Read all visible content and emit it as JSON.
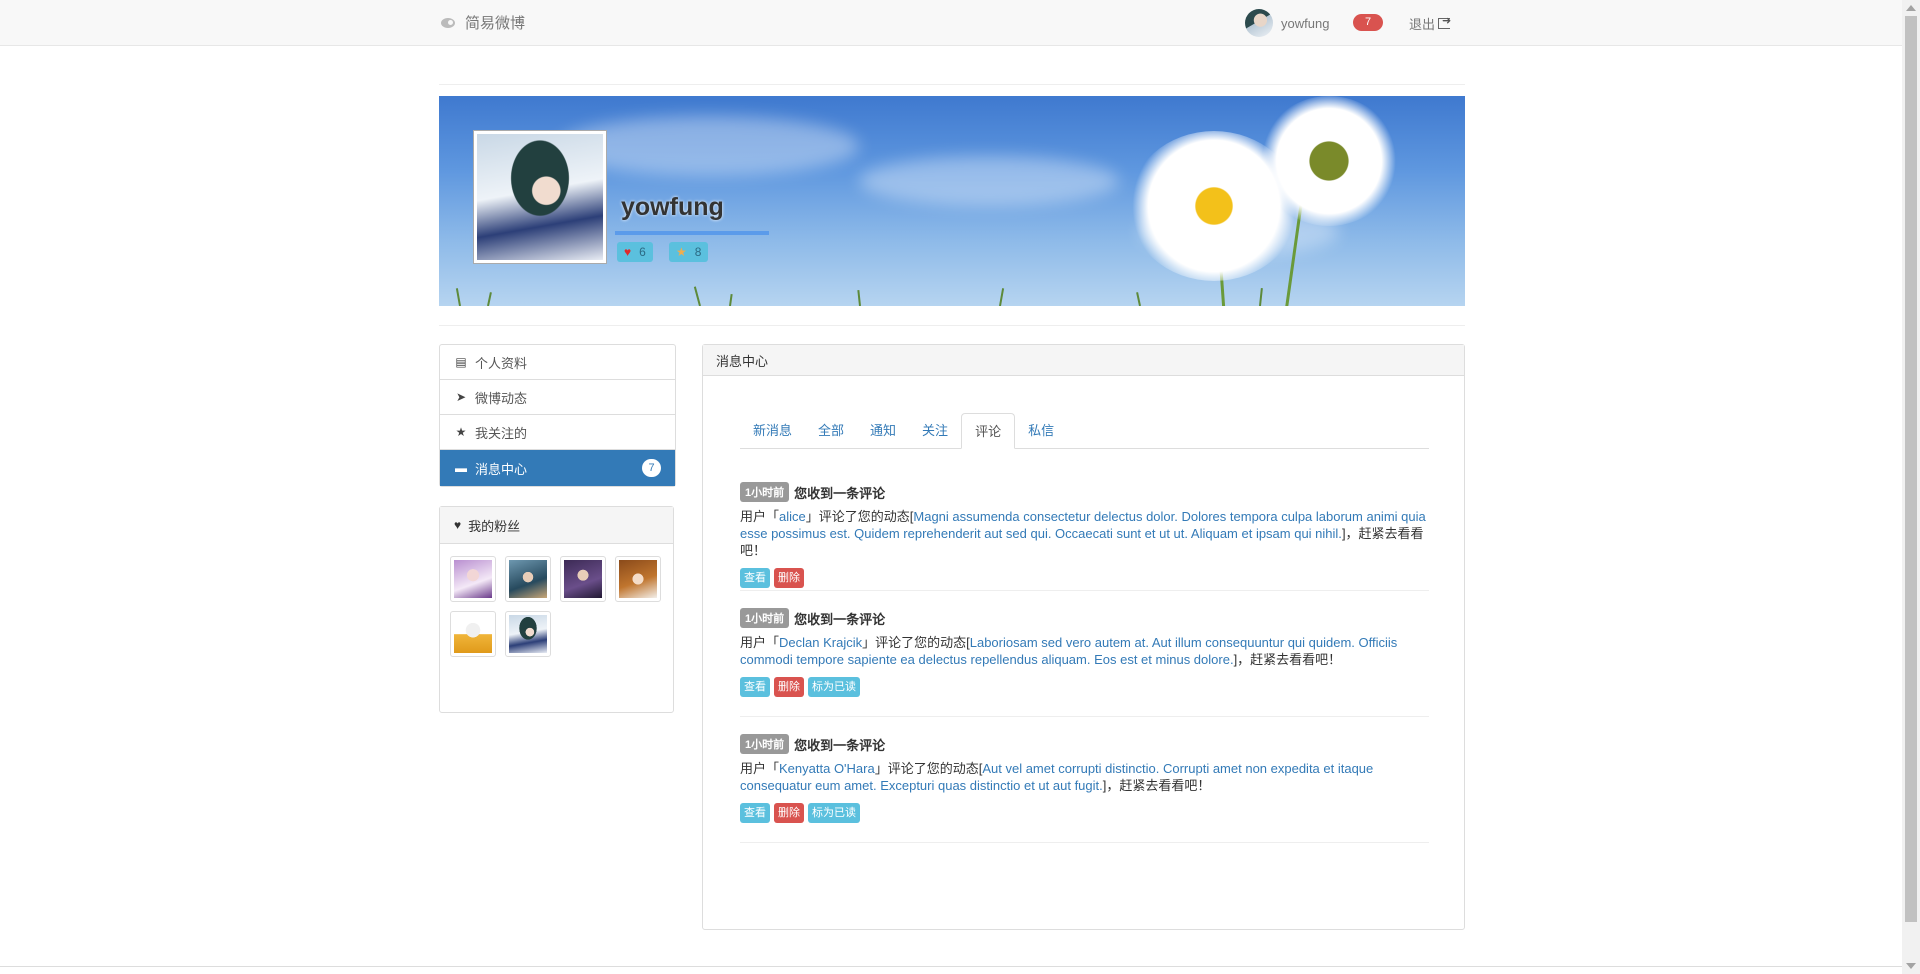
{
  "navbar": {
    "brand": "简易微博",
    "username": "yowfung",
    "notification_count": "7",
    "logout": "退出"
  },
  "profile": {
    "name": "yowfung",
    "likes": "6",
    "stars": "8"
  },
  "sidebar": {
    "items": [
      {
        "label": "个人资料",
        "icon": "address-book-icon"
      },
      {
        "label": "微博动态",
        "icon": "send-icon"
      },
      {
        "label": "我关注的",
        "icon": "star-icon"
      },
      {
        "label": "消息中心",
        "icon": "comment-icon",
        "badge": "7"
      }
    ],
    "fans_title": "我的粉丝"
  },
  "main": {
    "title": "消息中心",
    "tabs": [
      "新消息",
      "全部",
      "通知",
      "关注",
      "评论",
      "私信"
    ],
    "active_tab": "评论",
    "messages": [
      {
        "time": "1小时前",
        "title": "您收到一条评论",
        "prefix": "用户「",
        "user": "alice",
        "middle": "」评论了您的动态[",
        "content": "Magni assumenda consectetur delectus dolor. Dolores tempora culpa laborum animi quia esse possimus est. Quidem reprehenderit aut sed qui. Occaecati sunt et ut ut. Aliquam et ipsam qui nihil.",
        "suffix": "]，赶紧去看看吧！",
        "view": "查看",
        "delete": "删除"
      },
      {
        "time": "1小时前",
        "title": "您收到一条评论",
        "prefix": "用户「",
        "user": "Declan Krajcik",
        "middle": "」评论了您的动态[",
        "content": "Laboriosam sed vero autem at. Aut illum consequuntur qui quidem. Officiis commodi tempore sapiente ea delectus repellendus aliquam. Eos est et minus dolore.",
        "suffix": "]，赶紧去看看吧！",
        "view": "查看",
        "delete": "删除",
        "mark_read": "标为已读"
      },
      {
        "time": "1小时前",
        "title": "您收到一条评论",
        "prefix": "用户「",
        "user": "Kenyatta O'Hara",
        "middle": "」评论了您的动态[",
        "content": "Aut vel amet corrupti distinctio. Corrupti amet non expedita et itaque consequatur eum amet. Excepturi quas distinctio et ut aut fugit.",
        "suffix": "]，赶紧去看看吧！",
        "view": "查看",
        "delete": "删除",
        "mark_read": "标为已读"
      }
    ]
  },
  "colors": {
    "primary": "#337ab7",
    "info": "#5bc0de",
    "danger": "#d9534f",
    "label_default": "#999999"
  }
}
